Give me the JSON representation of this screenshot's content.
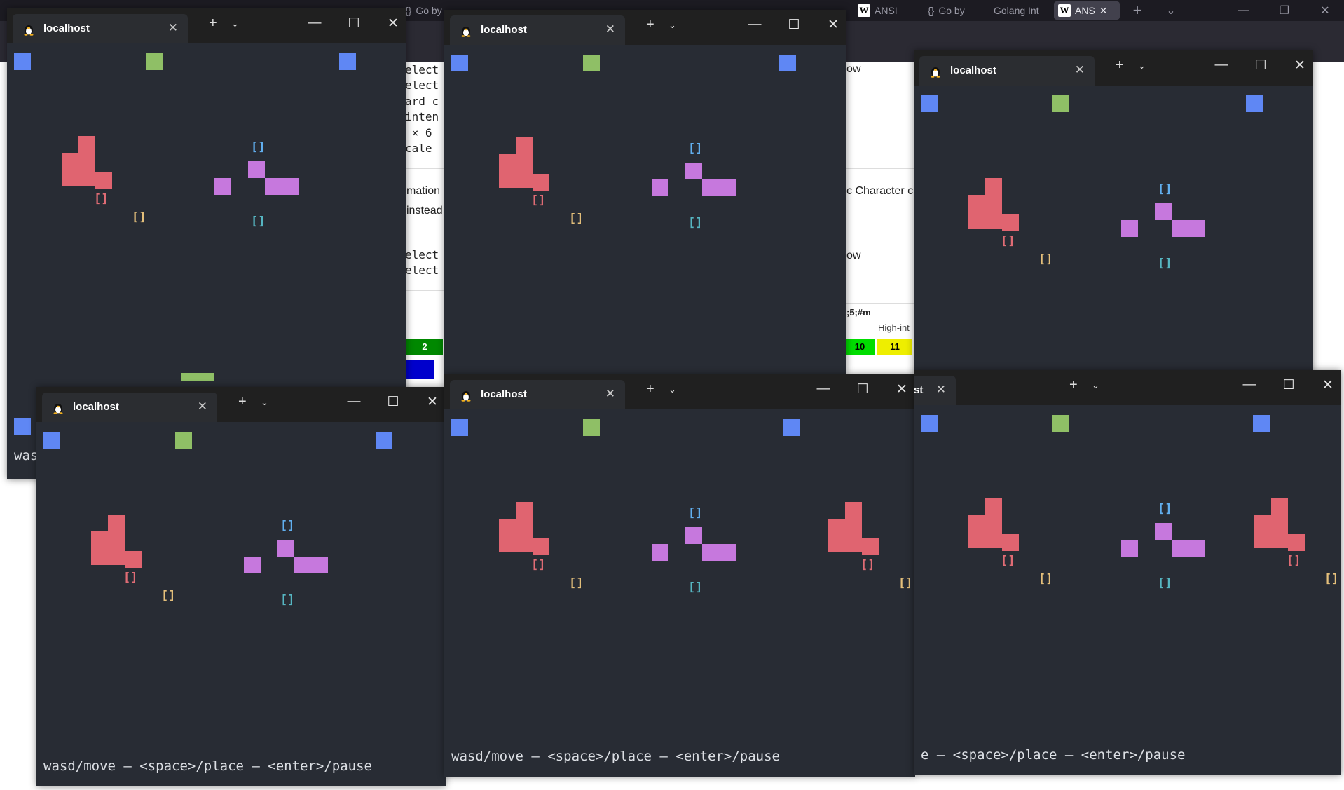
{
  "browser": {
    "tabs": [
      {
        "label": "Go by",
        "icon": "braces"
      },
      {
        "label": "ANSI",
        "icon": "W"
      },
      {
        "label": "Go by",
        "icon": "braces"
      },
      {
        "label": "Golang Int",
        "icon": ""
      },
      {
        "label": "ANS",
        "icon": "W"
      }
    ],
    "new_tab": "+",
    "tab_list": "⌄",
    "page_mono_lines": [
      "elect",
      "elect",
      "ard c",
      "inten",
      " × 6 ",
      "cale ",
      "elect",
      "elect"
    ],
    "page_text": [
      "mation",
      " instead",
      "ow",
      "c Character c",
      "ow",
      ";5;#m",
      "High-int"
    ],
    "colour_cells": [
      {
        "label": "2",
        "bg": "#008800",
        "fg": "#ffffff"
      },
      {
        "label": "10",
        "bg": "#00dd00",
        "fg": "#000000"
      },
      {
        "label": "11",
        "bg": "#eeee00",
        "fg": "#000000"
      }
    ]
  },
  "terminal": {
    "tab_title": "localhost",
    "tab_title_clipped": "st",
    "close": "✕",
    "new_tab": "+",
    "dropdown": "⌄",
    "minimize": "—",
    "maximize": "☐",
    "window_close": "✕",
    "block_label": "[]",
    "status_full": "wasd/move — <space>/place — <enter>/pause",
    "status_partial": "was",
    "status_tail": "e — <space>/place — <enter>/pause"
  },
  "colors": {
    "blue": "#5f87f4",
    "green": "#8fbf66",
    "red": "#e06470",
    "purple": "#c678dd",
    "label_red": "#e06c75",
    "label_yellow": "#e5c07b",
    "label_blue": "#61afef",
    "label_cyan": "#56b6c2",
    "terminal_bg": "#282c34"
  }
}
